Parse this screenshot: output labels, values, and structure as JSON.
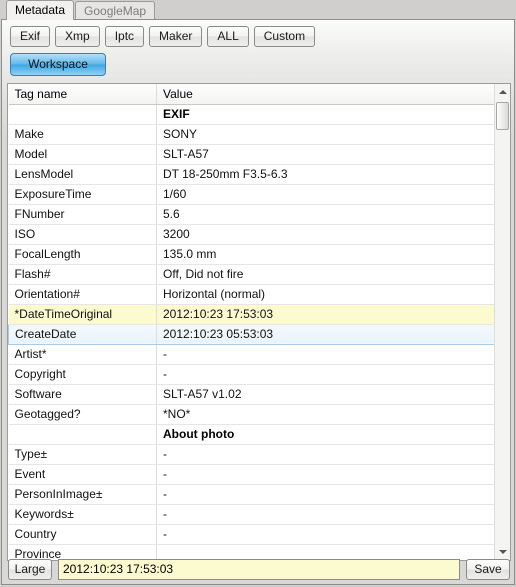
{
  "tabs": [
    {
      "label": "Metadata",
      "active": true
    },
    {
      "label": "GoogleMap",
      "active": false
    }
  ],
  "toolbar": {
    "filters": [
      "Exif",
      "Xmp",
      "Iptc",
      "Maker",
      "ALL",
      "Custom"
    ],
    "workspace_label": "Workspace"
  },
  "table": {
    "columns": [
      "Tag name",
      "Value"
    ],
    "rows": [
      {
        "tag": "",
        "value": "EXIF",
        "style": "group"
      },
      {
        "tag": "Make",
        "value": "SONY",
        "style": ""
      },
      {
        "tag": "Model",
        "value": "SLT-A57",
        "style": ""
      },
      {
        "tag": "LensModel",
        "value": "DT 18-250mm F3.5-6.3",
        "style": ""
      },
      {
        "tag": "ExposureTime",
        "value": "1/60",
        "style": ""
      },
      {
        "tag": "FNumber",
        "value": "5.6",
        "style": ""
      },
      {
        "tag": "ISO",
        "value": "3200",
        "style": ""
      },
      {
        "tag": "FocalLength",
        "value": "135.0 mm",
        "style": ""
      },
      {
        "tag": "Flash#",
        "value": "Off, Did not fire",
        "style": ""
      },
      {
        "tag": "Orientation#",
        "value": "Horizontal (normal)",
        "style": ""
      },
      {
        "tag": "*DateTimeOriginal",
        "value": "2012:10:23 17:53:03",
        "style": "highlight"
      },
      {
        "tag": "CreateDate",
        "value": "2012:10:23 05:53:03",
        "style": "selected"
      },
      {
        "tag": "Artist*",
        "value": "-",
        "style": ""
      },
      {
        "tag": "Copyright",
        "value": "-",
        "style": ""
      },
      {
        "tag": "Software",
        "value": "SLT-A57 v1.02",
        "style": ""
      },
      {
        "tag": "Geotagged?",
        "value": "*NO*",
        "style": ""
      },
      {
        "tag": "",
        "value": "About photo",
        "style": "group"
      },
      {
        "tag": "Type±",
        "value": "-",
        "style": ""
      },
      {
        "tag": "Event",
        "value": "-",
        "style": ""
      },
      {
        "tag": "PersonInImage±",
        "value": "-",
        "style": ""
      },
      {
        "tag": "Keywords±",
        "value": "-",
        "style": ""
      },
      {
        "tag": "Country",
        "value": "-",
        "style": ""
      },
      {
        "tag": "Province",
        "value": "",
        "style": ""
      }
    ]
  },
  "editbar": {
    "large_label": "Large",
    "value": "2012:10:23 17:53:03",
    "placeholder": "",
    "save_label": "Save"
  },
  "colors": {
    "highlight_row": "#fbfbcf",
    "selected_row": "#eaf3fb",
    "selected_border": "#a9cbe8",
    "accent_button": "#3da7e3"
  }
}
